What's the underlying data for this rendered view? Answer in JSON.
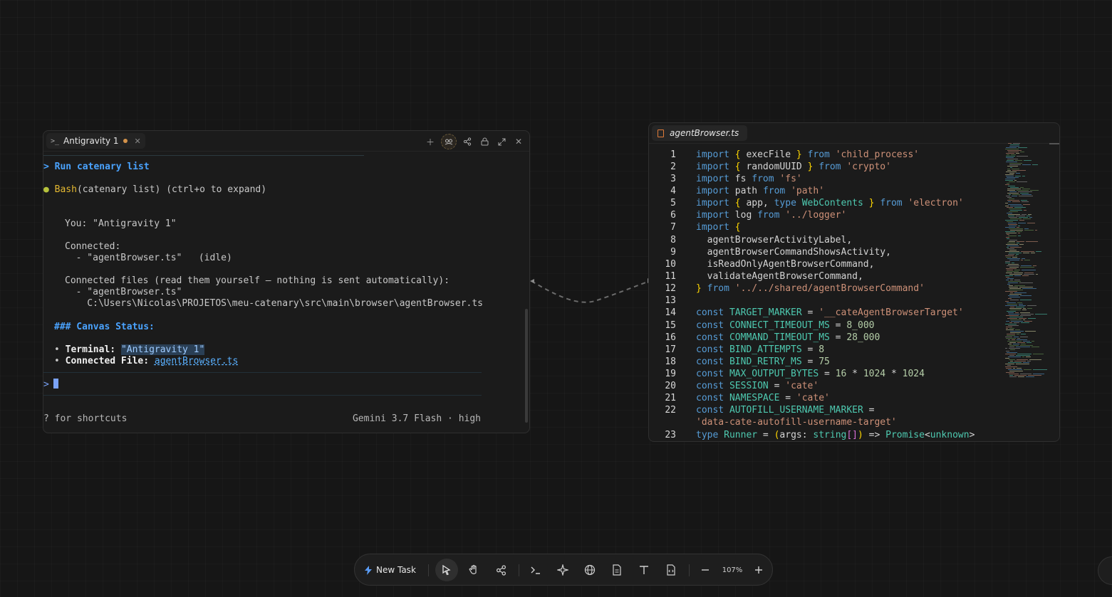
{
  "terminal": {
    "tab_title": "Antigravity 1",
    "lines": {
      "run": "> Run catenary list",
      "bash_label": "Bash",
      "bash_rest": "(catenary list) (ctrl+o to expand)",
      "you": "You: \"Antigravity 1\"",
      "connected": "Connected:",
      "connected_item": "  - \"agentBrowser.ts\"   (idle)",
      "files_header": "Connected files (read them yourself — nothing is sent automatically):",
      "files_item": "  - \"agentBrowser.ts\"",
      "files_path": "    C:\\Users\\Nicolas\\PROJETOS\\meu-catenary\\src\\main\\browser\\agentBrowser.ts",
      "canvas_status": "### Canvas Status:",
      "terminal_label": "Terminal:",
      "terminal_value": "\"Antigravity 1\"",
      "file_label": "Connected File:",
      "file_value": "agentBrowser.ts",
      "prompt": ">"
    },
    "footer_left": "? for shortcuts",
    "footer_right": "Gemini 3.7 Flash · high"
  },
  "editor": {
    "tab_title": "agentBrowser.ts",
    "line_numbers": [
      "1",
      "2",
      "3",
      "4",
      "5",
      "6",
      "7",
      "8",
      "9",
      "10",
      "11",
      "12",
      "13",
      "14",
      "15",
      "16",
      "17",
      "18",
      "19",
      "20",
      "21",
      "22",
      "",
      "23"
    ]
  },
  "toolbar": {
    "new_task": "New Task",
    "zoom": "107%"
  },
  "colors": {
    "background": "#161616",
    "accent_blue": "#4aa3ff",
    "keyword": "#569cd6",
    "string": "#ce9178",
    "type": "#4ec9b0",
    "bracket": "#ffd700",
    "status_dot": "#d4924a"
  }
}
